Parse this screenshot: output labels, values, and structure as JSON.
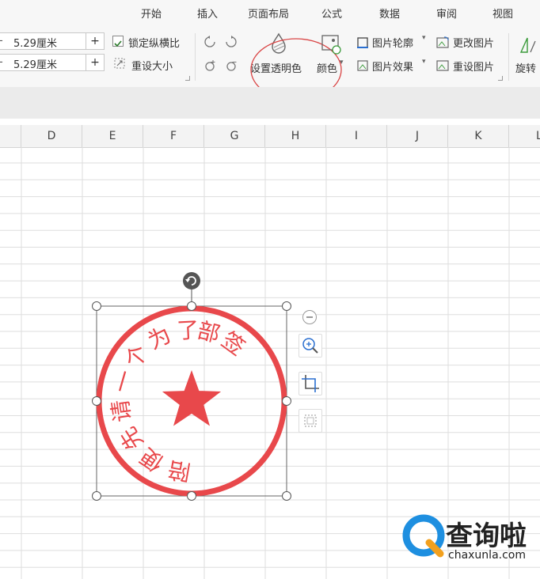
{
  "tabs": [
    "开始",
    "插入",
    "页面布局",
    "公式",
    "数据",
    "审阅",
    "视图"
  ],
  "size": {
    "height_value": "5.29厘米",
    "width_value": "5.29厘米",
    "minus_label": "-",
    "plus_label": "+",
    "lock_label": "锁定纵横比",
    "reset_size_label": "重设大小"
  },
  "picture_tools": {
    "transparent_label": "设置透明色",
    "color_label": "颜色",
    "outline_label": "图片轮廓",
    "effects_label": "图片效果",
    "change_label": "更改图片",
    "reset_label": "重设图片",
    "rotate_label": "旋转"
  },
  "columns": [
    "D",
    "E",
    "F",
    "G",
    "H",
    "I",
    "J",
    "K",
    "L"
  ],
  "stamp": {
    "text_chars": [
      "陪",
      "便",
      "先",
      "请",
      "一",
      "个",
      "为",
      "了",
      "部",
      "签"
    ],
    "color": "#e8484b"
  },
  "watermark": {
    "logo_text": "查询啦",
    "logo_url": "chaxunla.com"
  },
  "colors": {
    "accent": "#e8484b",
    "annotation": "#d94545",
    "logo_blue": "#1e8fe0",
    "logo_orange": "#f2a01e"
  }
}
